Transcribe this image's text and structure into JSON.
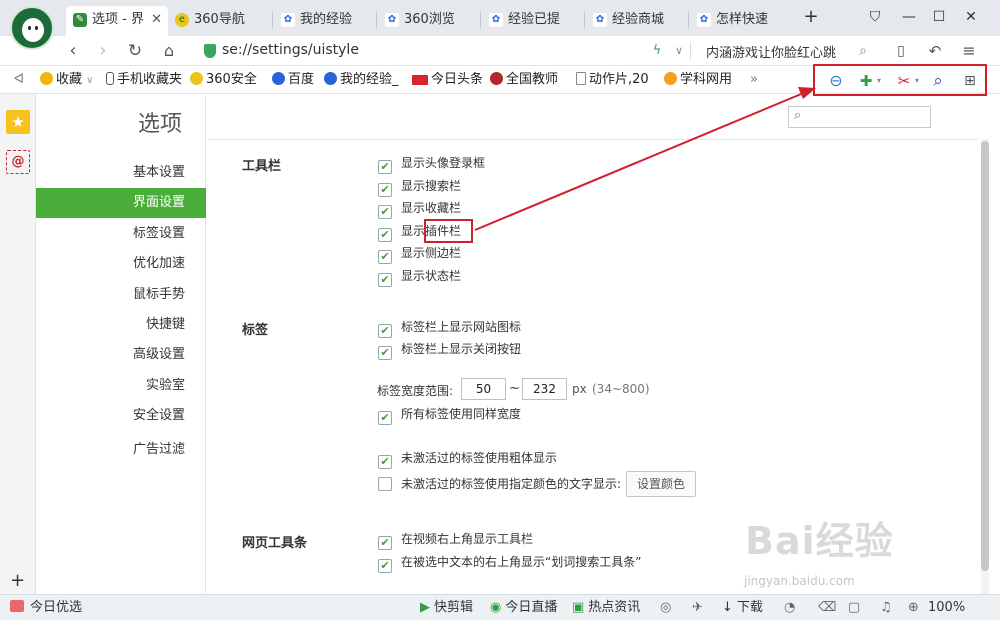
{
  "tabs": [
    {
      "label": "选项 - 界",
      "active": true,
      "icon": "wrench-icon"
    },
    {
      "label": "360导航",
      "icon": "360-logo-icon"
    },
    {
      "label": "我的经验",
      "icon": "baidu-paw-icon"
    },
    {
      "label": "360浏览",
      "icon": "baidu-paw-icon"
    },
    {
      "label": "经验已提",
      "icon": "baidu-paw-icon"
    },
    {
      "label": "经验商城",
      "icon": "baidu-paw-icon"
    },
    {
      "label": "怎样快速",
      "icon": "baidu-paw-icon"
    }
  ],
  "tab_add_label": "+",
  "address": {
    "url": "se://settings/uistyle",
    "search_hint": "内涵游戏让你脸红心跳"
  },
  "bookmarks": [
    {
      "label": "收藏",
      "icon": "star-icon"
    },
    {
      "label": "手机收藏夹",
      "icon": "phone-icon"
    },
    {
      "label": "360安全",
      "icon": "360-logo-icon"
    },
    {
      "label": "百度",
      "icon": "baidu-paw-icon"
    },
    {
      "label": "我的经验_",
      "icon": "baidu-paw-icon"
    },
    {
      "label": "今日头条",
      "icon": "toutiao-icon"
    },
    {
      "label": "全国教师",
      "icon": "teacher-icon"
    },
    {
      "label": "动作片,20",
      "icon": "page-icon"
    },
    {
      "label": "学科网用",
      "icon": "school-icon"
    }
  ],
  "bookmarks_more": "»",
  "page_title": "选项",
  "sidenav": [
    "基本设置",
    "界面设置",
    "标签设置",
    "优化加速",
    "鼠标手势",
    "快捷键",
    "高级设置",
    "实验室",
    "安全设置",
    "广告过滤"
  ],
  "sidenav_selected": "界面设置",
  "sections": {
    "toolbar": {
      "title": "工具栏",
      "items": [
        {
          "label": "显示头像登录框",
          "checked": true
        },
        {
          "label": "显示搜索栏",
          "checked": true
        },
        {
          "label": "显示收藏栏",
          "checked": true
        },
        {
          "label": "显示插件栏",
          "checked": true
        },
        {
          "label": "显示侧边栏",
          "checked": true
        },
        {
          "label": "显示状态栏",
          "checked": true
        }
      ]
    },
    "tabs": {
      "title": "标签",
      "items": [
        {
          "label": "标签栏上显示网站图标",
          "checked": true
        },
        {
          "label": "标签栏上显示关闭按钮",
          "checked": true
        }
      ],
      "width_label": "标签宽度范围:",
      "width_min": "50",
      "width_sep": "~",
      "width_max": "232",
      "width_unit": "px",
      "width_range_hint": "(34~800)",
      "same_width_label": "所有标签使用同样宽度",
      "same_width_checked": true,
      "inactive_bold_label": "未激活过的标签使用粗体显示",
      "inactive_bold_checked": true,
      "inactive_color_label": "未激活过的标签使用指定颜色的文字显示:",
      "inactive_color_checked": false,
      "set_color_button": "设置颜色"
    },
    "webtoolbar": {
      "title": "网页工具条",
      "items": [
        {
          "label": "在视频右上角显示工具栏",
          "checked": true
        },
        {
          "label": "在被选中文本的右上角显示“划词搜索工具条”",
          "checked": true
        }
      ]
    }
  },
  "status": {
    "left": "今日优选",
    "items": [
      "快剪辑",
      "今日直播",
      "热点资讯",
      "下载"
    ],
    "zoom": "100%"
  },
  "watermark": {
    "brand": "Bai经验",
    "url": "jingyan.baidu.com"
  },
  "colors": {
    "accent": "#4cae3a",
    "highlight": "#d0202b"
  }
}
